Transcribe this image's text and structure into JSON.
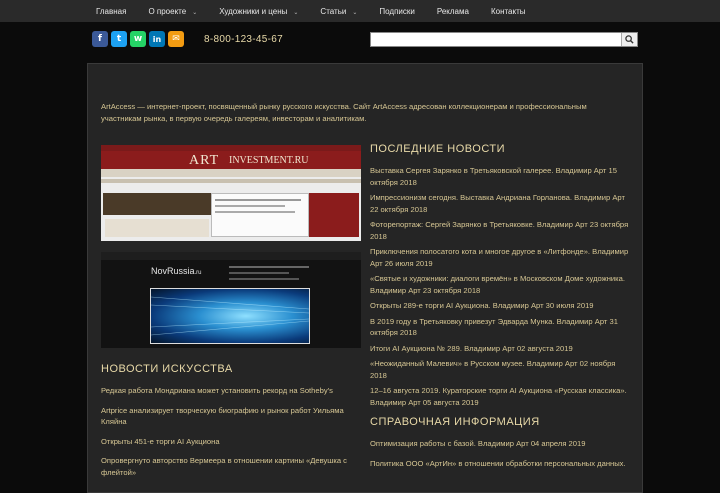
{
  "nav": {
    "items": [
      {
        "label": "Главная",
        "dropdown": false
      },
      {
        "label": "О проекте",
        "dropdown": true
      },
      {
        "label": "Художники и цены",
        "dropdown": true
      },
      {
        "label": "Статьи",
        "dropdown": true
      },
      {
        "label": "Подписки",
        "dropdown": false
      },
      {
        "label": "Реклама",
        "dropdown": false
      },
      {
        "label": "Контакты",
        "dropdown": false
      }
    ],
    "chevron": "⌄"
  },
  "social": [
    {
      "name": "facebook-icon",
      "glyph": "f",
      "color": "#3b5998"
    },
    {
      "name": "twitter-icon",
      "glyph": "t",
      "color": "#1da1f2"
    },
    {
      "name": "whatsapp-icon",
      "glyph": "w",
      "color": "#25d366"
    },
    {
      "name": "linkedin-icon",
      "glyph": "in",
      "color": "#0077b5"
    },
    {
      "name": "email-icon",
      "glyph": "✉",
      "color": "#f39c12"
    }
  ],
  "phone": "8-800-123-45-67",
  "search": {
    "placeholder": "",
    "icon": "search-icon"
  },
  "intro": "ArtAccess — интернет-проект, посвященный рынку русского искусства. Сайт ArtAccess адресован коллекционерам и профессиональным участникам рынка, в первую очередь галереям, инвесторам и аналитикам.",
  "banner1": {
    "logo": "ART",
    "logo2": "INVESTMENT.RU"
  },
  "banner2": {
    "logo": "NovRussia",
    "logo_suffix": ".ru"
  },
  "latest_news": {
    "title": "ПОСЛЕДНИЕ НОВОСТИ",
    "items": [
      "Выставка Сергея Зарянко в Третьяковской галерее. Владимир Арт   15 октября 2018",
      "Импрессионизм сегодня. Выставка Андриана Горланова. Владимир Арт   22 октября 2018",
      "Фоторепортаж: Сергей Зарянко в Третьяковке. Владимир Арт   23 октября 2018",
      "Приключения полосатого кота и многое другое в «Литфонде». Владимир Арт   26 июля 2019",
      "«Святые и художники: диалоги времён» в Московском Доме художника. Владимир Арт   23 октября 2018",
      "Открыты 289-е торги AI Аукциона. Владимир Арт   30 июля 2019",
      "В 2019 году в Третьяковку привезут Эдварда Мунка. Владимир Арт   31 октября 2018",
      "Итоги AI Аукциона № 289. Владимир Арт   02 августа 2019",
      "«Неожиданный Малевич» в Русском музее. Владимир Арт   02 ноября 2018",
      "12–16 августа 2019. Кураторские торги AI Аукциона «Русская классика». Владимир Арт   05 августа 2019"
    ]
  },
  "reference": {
    "title": "СПРАВОЧНАЯ ИНФОРМАЦИЯ",
    "items": [
      "Оптимизация работы с базой. Владимир Арт   04 апреля 2019",
      "Политика ООО «АртИн» в отношении обработки персональных данных."
    ]
  },
  "art_news": {
    "title": "НОВОСТИ ИСКУССТВА",
    "items": [
      "Редкая работа Мондриана может установить рекорд на Sotheby's",
      "Artprice анализирует творческую биографию и рынок работ Уильяма Кляйна",
      "Открыты 451-е торги AI Аукциона",
      "Опровергнуто авторство Вермеера в отношении картины «Девушка с флейтой»"
    ]
  }
}
